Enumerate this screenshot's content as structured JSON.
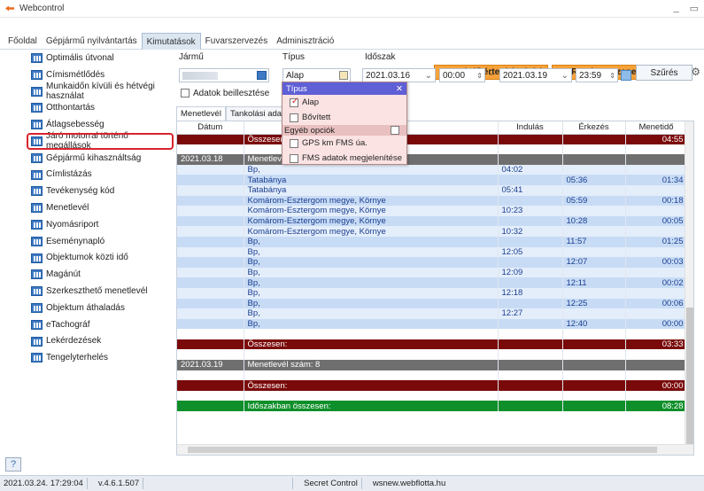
{
  "window": {
    "title": "Webcontrol",
    "min": "_",
    "max": "▭",
    "close": "✕"
  },
  "menu": {
    "tabs": [
      "Főoldal",
      "Gépjármű nyilvántartás",
      "Kimutatások",
      "Fuvarszervezés",
      "Adminisztráció"
    ],
    "active": 2
  },
  "alerts": {
    "email": "E-útdíj értesítések (9)",
    "system": "Rendszerüzenetek (730)"
  },
  "sidebar": {
    "items": [
      "Optimális útvonal",
      "Címismétlődés",
      "Munkaidőn kívüli és hétvégi használat",
      "Otthontartás",
      "Átlagsebesség",
      "Járó motorral történő megállások",
      "Gépjármű kihasználtság",
      "Címlistázás",
      "Tevékenység kód",
      "Menetlevél",
      "Nyomásriport",
      "Eseménynapló",
      "Objektumok közti idő",
      "Magánút",
      "Szerkeszthető menetlevél",
      "Objektum áthaladás",
      "eTachográf",
      "Lekérdezések",
      "Tengelyterhelés"
    ],
    "selected": 9,
    "help": "?"
  },
  "filters": {
    "vehicle_label": "Jármű",
    "type_label": "Típus",
    "type_value": "Alap",
    "period_label": "Időszak",
    "date_from": "2021.03.16",
    "time_from": "00:00",
    "dash": "-",
    "date_to": "2021.03.19",
    "time_to": "23:59",
    "data_insert_label": "Adatok beillesztése",
    "filter_button": "Szűrés"
  },
  "subtabs": [
    "Menetlevél",
    "Tankolási adatok"
  ],
  "popup": {
    "title": "Típus",
    "close": "✕",
    "opt1": "Alap",
    "opt2": "Bővített",
    "group": "Egyéb opciók",
    "opt3": "GPS km FMS úa.",
    "opt4": "FMS adatok megjelenítése"
  },
  "table": {
    "headers": [
      "Dátum",
      "",
      "Indulás",
      "Érkezés",
      "Menetidő"
    ],
    "rows": [
      {
        "style": "r-red",
        "date": "",
        "place": "Összesen:",
        "dep": "",
        "arr": "",
        "dur": "04:55"
      },
      {
        "style": "r-white",
        "date": "",
        "place": "",
        "dep": "",
        "arr": "",
        "dur": ""
      },
      {
        "style": "r-grey",
        "date": "2021.03.18",
        "place": "Menetlevél",
        "dep": "",
        "arr": "",
        "dur": ""
      },
      {
        "style": "r-lblue",
        "date": "",
        "place": "Bp,",
        "dep": "04:02",
        "arr": "",
        "dur": ""
      },
      {
        "style": "r-blue",
        "date": "",
        "place": "Tatabánya",
        "dep": "",
        "arr": "05:36",
        "dur": "01:34"
      },
      {
        "style": "r-lblue",
        "date": "",
        "place": "Tatabánya",
        "dep": "05:41",
        "arr": "",
        "dur": ""
      },
      {
        "style": "r-blue",
        "date": "",
        "place": "Komárom-Esztergom megye, Környe",
        "dep": "",
        "arr": "05:59",
        "dur": "00:18"
      },
      {
        "style": "r-lblue",
        "date": "",
        "place": "Komárom-Esztergom megye, Környe",
        "dep": "10:23",
        "arr": "",
        "dur": ""
      },
      {
        "style": "r-blue",
        "date": "",
        "place": "Komárom-Esztergom megye, Környe",
        "dep": "",
        "arr": "10:28",
        "dur": "00:05"
      },
      {
        "style": "r-lblue",
        "date": "",
        "place": "Komárom-Esztergom megye, Környe",
        "dep": "10:32",
        "arr": "",
        "dur": ""
      },
      {
        "style": "r-blue",
        "date": "",
        "place": "Bp,",
        "dep": "",
        "arr": "11:57",
        "dur": "01:25"
      },
      {
        "style": "r-lblue",
        "date": "",
        "place": "Bp,",
        "dep": "12:05",
        "arr": "",
        "dur": ""
      },
      {
        "style": "r-blue",
        "date": "",
        "place": "Bp,",
        "dep": "",
        "arr": "12:07",
        "dur": "00:03"
      },
      {
        "style": "r-lblue",
        "date": "",
        "place": "Bp,",
        "dep": "12:09",
        "arr": "",
        "dur": ""
      },
      {
        "style": "r-blue",
        "date": "",
        "place": "Bp,",
        "dep": "",
        "arr": "12:11",
        "dur": "00:02"
      },
      {
        "style": "r-lblue",
        "date": "",
        "place": "Bp,",
        "dep": "12:18",
        "arr": "",
        "dur": ""
      },
      {
        "style": "r-blue",
        "date": "",
        "place": "Bp,",
        "dep": "",
        "arr": "12:25",
        "dur": "00:06"
      },
      {
        "style": "r-lblue",
        "date": "",
        "place": "Bp,",
        "dep": "12:27",
        "arr": "",
        "dur": ""
      },
      {
        "style": "r-blue",
        "date": "",
        "place": "Bp,",
        "dep": "",
        "arr": "12:40",
        "dur": "00:00"
      },
      {
        "style": "r-white",
        "date": "",
        "place": "",
        "dep": "",
        "arr": "",
        "dur": ""
      },
      {
        "style": "r-red",
        "date": "",
        "place": "Összesen:",
        "dep": "",
        "arr": "",
        "dur": "03:33"
      },
      {
        "style": "r-white",
        "date": "",
        "place": "",
        "dep": "",
        "arr": "",
        "dur": ""
      },
      {
        "style": "r-grey",
        "date": "2021.03.19",
        "place": "Menetlevél szám: 8",
        "dep": "",
        "arr": "",
        "dur": ""
      },
      {
        "style": "r-white",
        "date": "",
        "place": "",
        "dep": "",
        "arr": "",
        "dur": ""
      },
      {
        "style": "r-red",
        "date": "",
        "place": "Összesen:",
        "dep": "",
        "arr": "",
        "dur": "00:00"
      },
      {
        "style": "r-white",
        "date": "",
        "place": "",
        "dep": "",
        "arr": "",
        "dur": ""
      },
      {
        "style": "r-green",
        "date": "",
        "place": "Időszakban összesen:",
        "dep": "",
        "arr": "",
        "dur": "08:28"
      }
    ]
  },
  "status": {
    "datetime": "2021.03.24. 17:29:04",
    "version": "v.4.6.1.507",
    "service": "Secret Control",
    "server": "wsnew.webflotta.hu"
  }
}
